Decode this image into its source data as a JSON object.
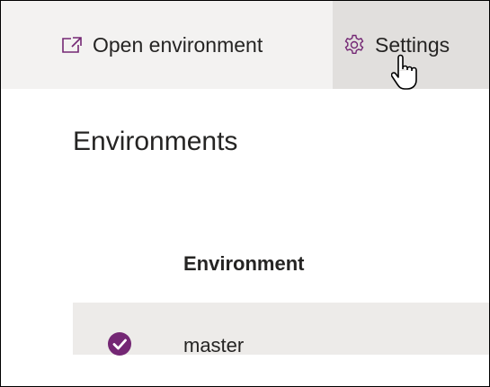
{
  "toolbar": {
    "open_environment": {
      "label": "Open environment",
      "icon": "open-in-new-icon"
    },
    "settings": {
      "label": "Settings",
      "icon": "gear-icon"
    }
  },
  "page": {
    "title": "Environments"
  },
  "table": {
    "column_header": "Environment",
    "rows": [
      {
        "name": "master",
        "selected": true,
        "icon": "check-circle-icon"
      }
    ]
  },
  "colors": {
    "accent": "#742774",
    "toolbar_bg": "#f3f2f1",
    "hover_bg": "#e1dfdd",
    "row_selected_bg": "#edebe9"
  }
}
